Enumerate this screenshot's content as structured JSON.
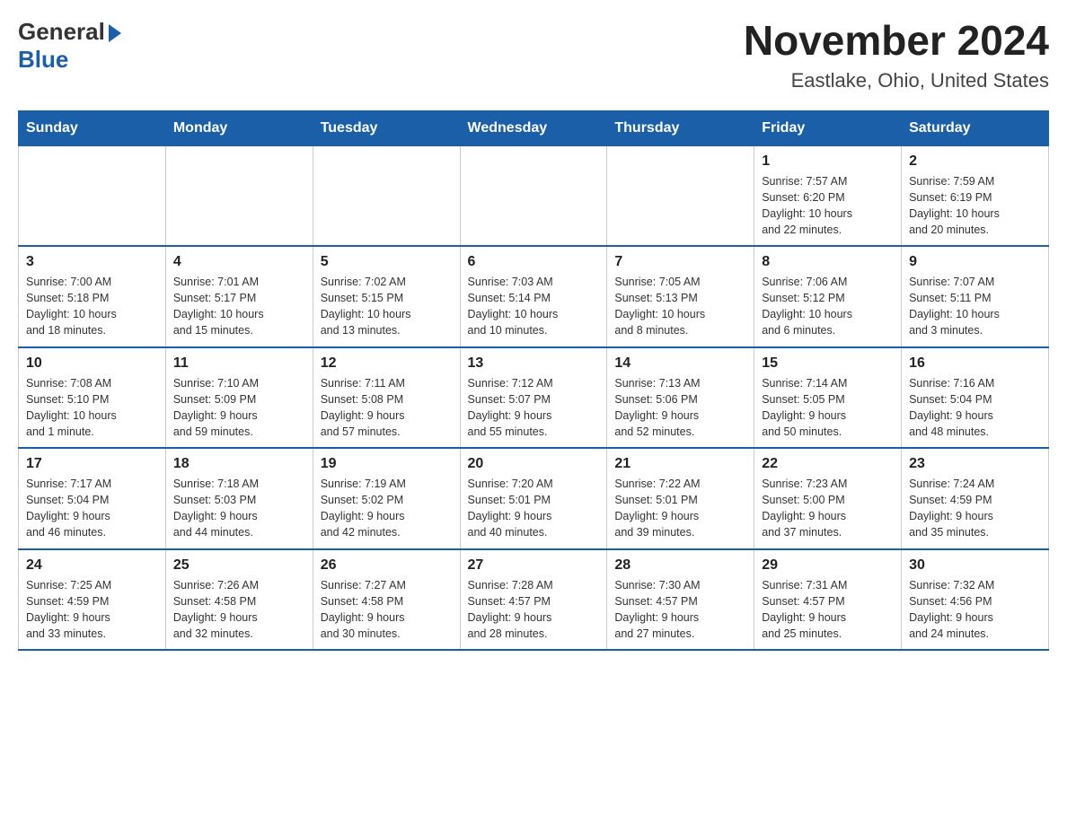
{
  "header": {
    "logo_general": "General",
    "logo_blue": "Blue",
    "title": "November 2024",
    "subtitle": "Eastlake, Ohio, United States"
  },
  "days_of_week": [
    "Sunday",
    "Monday",
    "Tuesday",
    "Wednesday",
    "Thursday",
    "Friday",
    "Saturday"
  ],
  "weeks": [
    {
      "days": [
        {
          "num": "",
          "info": "",
          "empty": true
        },
        {
          "num": "",
          "info": "",
          "empty": true
        },
        {
          "num": "",
          "info": "",
          "empty": true
        },
        {
          "num": "",
          "info": "",
          "empty": true
        },
        {
          "num": "",
          "info": "",
          "empty": true
        },
        {
          "num": "1",
          "info": "Sunrise: 7:57 AM\nSunset: 6:20 PM\nDaylight: 10 hours\nand 22 minutes.",
          "empty": false
        },
        {
          "num": "2",
          "info": "Sunrise: 7:59 AM\nSunset: 6:19 PM\nDaylight: 10 hours\nand 20 minutes.",
          "empty": false
        }
      ]
    },
    {
      "days": [
        {
          "num": "3",
          "info": "Sunrise: 7:00 AM\nSunset: 5:18 PM\nDaylight: 10 hours\nand 18 minutes.",
          "empty": false
        },
        {
          "num": "4",
          "info": "Sunrise: 7:01 AM\nSunset: 5:17 PM\nDaylight: 10 hours\nand 15 minutes.",
          "empty": false
        },
        {
          "num": "5",
          "info": "Sunrise: 7:02 AM\nSunset: 5:15 PM\nDaylight: 10 hours\nand 13 minutes.",
          "empty": false
        },
        {
          "num": "6",
          "info": "Sunrise: 7:03 AM\nSunset: 5:14 PM\nDaylight: 10 hours\nand 10 minutes.",
          "empty": false
        },
        {
          "num": "7",
          "info": "Sunrise: 7:05 AM\nSunset: 5:13 PM\nDaylight: 10 hours\nand 8 minutes.",
          "empty": false
        },
        {
          "num": "8",
          "info": "Sunrise: 7:06 AM\nSunset: 5:12 PM\nDaylight: 10 hours\nand 6 minutes.",
          "empty": false
        },
        {
          "num": "9",
          "info": "Sunrise: 7:07 AM\nSunset: 5:11 PM\nDaylight: 10 hours\nand 3 minutes.",
          "empty": false
        }
      ]
    },
    {
      "days": [
        {
          "num": "10",
          "info": "Sunrise: 7:08 AM\nSunset: 5:10 PM\nDaylight: 10 hours\nand 1 minute.",
          "empty": false
        },
        {
          "num": "11",
          "info": "Sunrise: 7:10 AM\nSunset: 5:09 PM\nDaylight: 9 hours\nand 59 minutes.",
          "empty": false
        },
        {
          "num": "12",
          "info": "Sunrise: 7:11 AM\nSunset: 5:08 PM\nDaylight: 9 hours\nand 57 minutes.",
          "empty": false
        },
        {
          "num": "13",
          "info": "Sunrise: 7:12 AM\nSunset: 5:07 PM\nDaylight: 9 hours\nand 55 minutes.",
          "empty": false
        },
        {
          "num": "14",
          "info": "Sunrise: 7:13 AM\nSunset: 5:06 PM\nDaylight: 9 hours\nand 52 minutes.",
          "empty": false
        },
        {
          "num": "15",
          "info": "Sunrise: 7:14 AM\nSunset: 5:05 PM\nDaylight: 9 hours\nand 50 minutes.",
          "empty": false
        },
        {
          "num": "16",
          "info": "Sunrise: 7:16 AM\nSunset: 5:04 PM\nDaylight: 9 hours\nand 48 minutes.",
          "empty": false
        }
      ]
    },
    {
      "days": [
        {
          "num": "17",
          "info": "Sunrise: 7:17 AM\nSunset: 5:04 PM\nDaylight: 9 hours\nand 46 minutes.",
          "empty": false
        },
        {
          "num": "18",
          "info": "Sunrise: 7:18 AM\nSunset: 5:03 PM\nDaylight: 9 hours\nand 44 minutes.",
          "empty": false
        },
        {
          "num": "19",
          "info": "Sunrise: 7:19 AM\nSunset: 5:02 PM\nDaylight: 9 hours\nand 42 minutes.",
          "empty": false
        },
        {
          "num": "20",
          "info": "Sunrise: 7:20 AM\nSunset: 5:01 PM\nDaylight: 9 hours\nand 40 minutes.",
          "empty": false
        },
        {
          "num": "21",
          "info": "Sunrise: 7:22 AM\nSunset: 5:01 PM\nDaylight: 9 hours\nand 39 minutes.",
          "empty": false
        },
        {
          "num": "22",
          "info": "Sunrise: 7:23 AM\nSunset: 5:00 PM\nDaylight: 9 hours\nand 37 minutes.",
          "empty": false
        },
        {
          "num": "23",
          "info": "Sunrise: 7:24 AM\nSunset: 4:59 PM\nDaylight: 9 hours\nand 35 minutes.",
          "empty": false
        }
      ]
    },
    {
      "days": [
        {
          "num": "24",
          "info": "Sunrise: 7:25 AM\nSunset: 4:59 PM\nDaylight: 9 hours\nand 33 minutes.",
          "empty": false
        },
        {
          "num": "25",
          "info": "Sunrise: 7:26 AM\nSunset: 4:58 PM\nDaylight: 9 hours\nand 32 minutes.",
          "empty": false
        },
        {
          "num": "26",
          "info": "Sunrise: 7:27 AM\nSunset: 4:58 PM\nDaylight: 9 hours\nand 30 minutes.",
          "empty": false
        },
        {
          "num": "27",
          "info": "Sunrise: 7:28 AM\nSunset: 4:57 PM\nDaylight: 9 hours\nand 28 minutes.",
          "empty": false
        },
        {
          "num": "28",
          "info": "Sunrise: 7:30 AM\nSunset: 4:57 PM\nDaylight: 9 hours\nand 27 minutes.",
          "empty": false
        },
        {
          "num": "29",
          "info": "Sunrise: 7:31 AM\nSunset: 4:57 PM\nDaylight: 9 hours\nand 25 minutes.",
          "empty": false
        },
        {
          "num": "30",
          "info": "Sunrise: 7:32 AM\nSunset: 4:56 PM\nDaylight: 9 hours\nand 24 minutes.",
          "empty": false
        }
      ]
    }
  ]
}
